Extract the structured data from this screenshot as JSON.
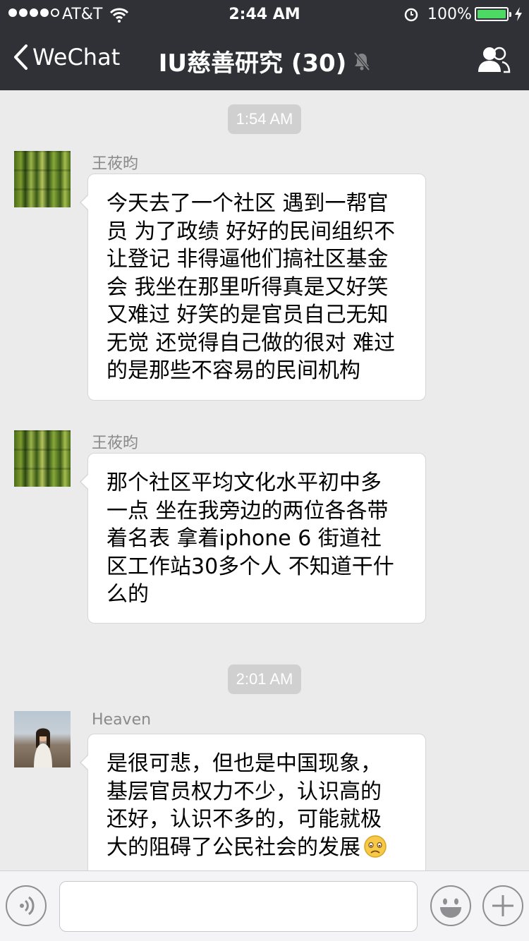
{
  "status_bar": {
    "carrier": "AT&T",
    "time": "2:44 AM",
    "battery_percent": "100%",
    "signal_bars_filled": 4,
    "signal_bars_total": 5,
    "battery_level": 1.0
  },
  "nav": {
    "back_label": "WeChat",
    "title": "IU慈善研究 (30)"
  },
  "chat": {
    "timestamps": [
      "1:54 AM",
      "2:01 AM"
    ],
    "messages": [
      {
        "sender": "王莜昀",
        "lines": [
          "今天去了一个社区 遇到一帮官",
          "员 为了政绩 好好的民间组织不",
          "让登记 非得逼他们搞社区基金",
          "会 我坐在那里听得真是又好笑",
          "又难过 好笑的是官员自己无知",
          "无觉 还觉得自己做的很对 难过",
          "的是那些不容易的民间机构"
        ]
      },
      {
        "sender": "王莜昀",
        "lines": [
          "那个社区平均文化水平初中多",
          "一点 坐在我旁边的两位各各带",
          "着名表  拿着iphone 6 街道社",
          "区工作站30多个人 不知道干什",
          "么的"
        ]
      },
      {
        "sender": "Heaven",
        "lines": [
          "是很可悲，但也是中国现象，",
          "基层官员权力不少，认识高的",
          "还好，认识不多的，可能就极",
          "大的阻碍了公民社会的发展"
        ]
      }
    ]
  },
  "colors": {
    "nav_bg": "#2f3136",
    "chat_bg": "#ebebeb",
    "battery_green": "#4cd964"
  },
  "icons": [
    "wifi-icon",
    "alarm-icon",
    "charging-icon",
    "back-chevron-icon",
    "mute-icon",
    "group-members-icon",
    "sad-emoji-icon",
    "voice-icon",
    "emoji-icon",
    "plus-icon"
  ]
}
